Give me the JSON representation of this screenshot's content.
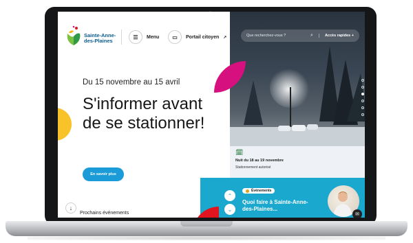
{
  "header": {
    "brand": "Sainte-Anne-\ndes-Plaines",
    "menu_label": "Menu",
    "portail_label": "Portail citoyen",
    "search_placeholder": "Que recherchez-vous ?",
    "quick_access_label": "Accès rapides"
  },
  "hero": {
    "date": "Du 15 novembre au 15 avril",
    "title": "S'informer avant de se stationner!",
    "cta_label": "En savoir plus"
  },
  "event_card": {
    "date": "Nuit du 18 au 19 novembre",
    "title": "Stationnement autorisé"
  },
  "events_section": {
    "next_label": "Prochains événements",
    "badge": "Événements",
    "title": "Quoi faire à Sainte-Anne-des-Plaines..."
  },
  "icons": {
    "menu": "menu-icon",
    "portail": "id-card-icon",
    "external": "external-link-icon",
    "search": "search-icon",
    "plus": "plus-icon",
    "arrow_down": "arrow-down-icon",
    "chevron_up": "chevron-up-icon",
    "chevron_down": "chevron-down-icon",
    "calendar": "calendar-icon",
    "chat": "chat-icon"
  },
  "colors": {
    "accent_blue": "#1b9bd8",
    "teal": "#1ba8cf",
    "pink": "#d6117f",
    "yellow": "#f8c22a",
    "red": "#e1151f"
  },
  "carousel": {
    "count": 6,
    "active_index": 3
  }
}
